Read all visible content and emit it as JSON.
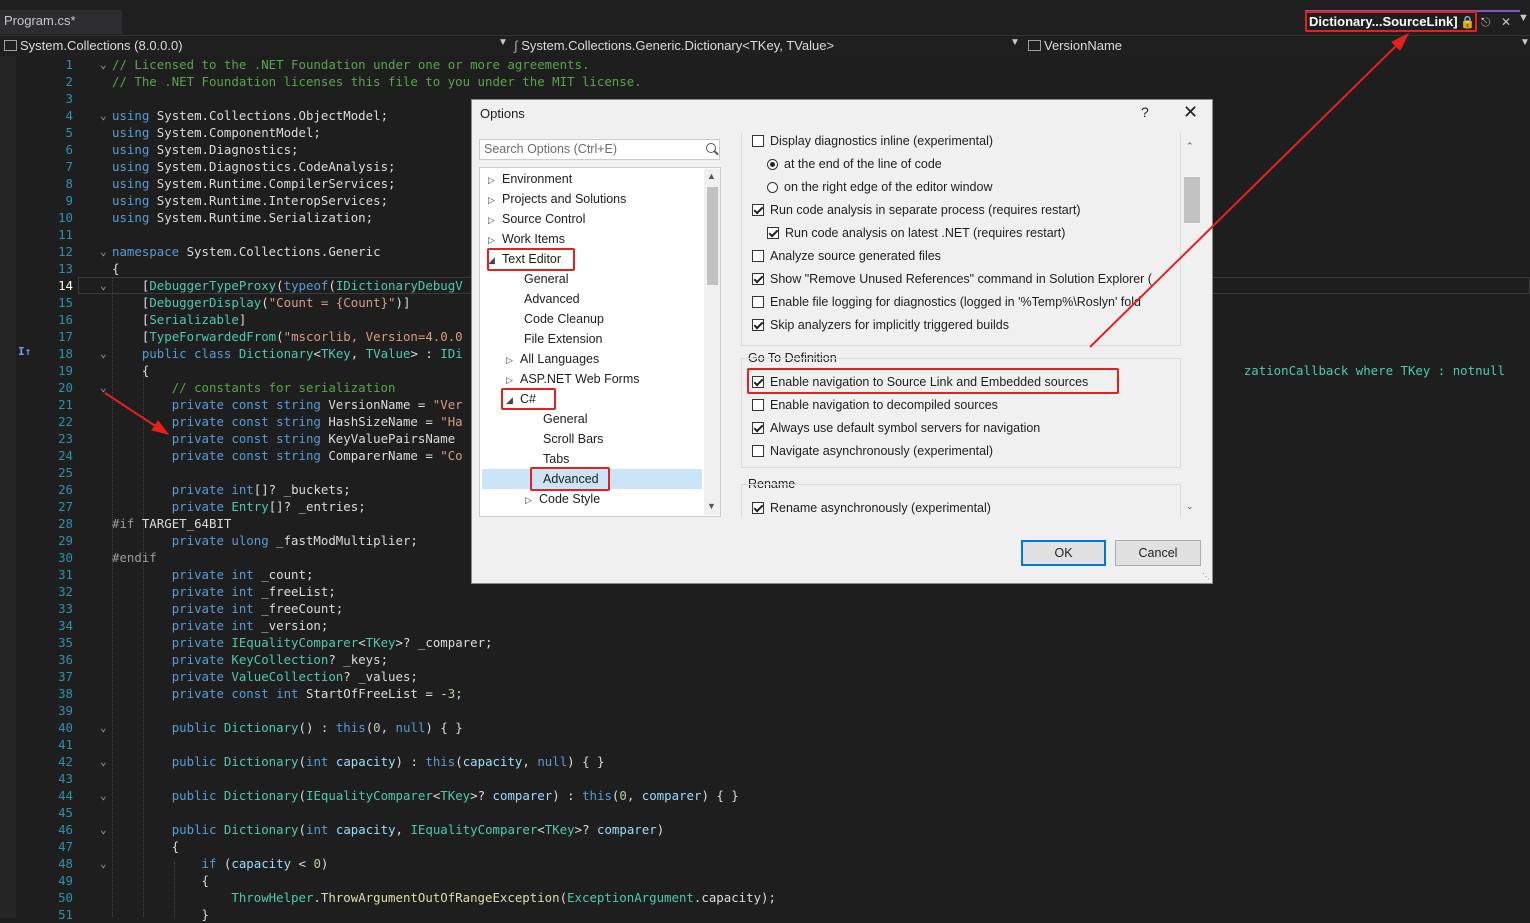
{
  "tabs": {
    "program": "Program.cs*",
    "active": "Dictionary...SourceLink]"
  },
  "navbar": {
    "project": "System.Collections (8.0.0.0)",
    "type": "System.Collections.Generic.Dictionary<TKey, TValue>",
    "member": "VersionName"
  },
  "editor": {
    "line_numbers": [
      "1",
      "2",
      "3",
      "4",
      "5",
      "6",
      "7",
      "8",
      "9",
      "10",
      "11",
      "12",
      "13",
      "14",
      "15",
      "16",
      "17",
      "18",
      "19",
      "20",
      "21",
      "22",
      "23",
      "24",
      "25",
      "26",
      "27",
      "28",
      "29",
      "30",
      "31",
      "32",
      "33",
      "34",
      "35",
      "36",
      "37",
      "38",
      "39",
      "40",
      "41",
      "42",
      "43",
      "44",
      "45",
      "46",
      "47",
      "48",
      "49",
      "50",
      "51"
    ],
    "current_line": "14",
    "line18_overflow": "zationCallback where TKey : notnull",
    "line18_marker": "I↑"
  },
  "dialog": {
    "title": "Options",
    "help": "?",
    "close": "✕",
    "search_placeholder": "Search Options (Ctrl+E)",
    "tree": [
      "Environment",
      "Projects and Solutions",
      "Source Control",
      "Work Items",
      "Text Editor",
      "General",
      "Advanced",
      "Code Cleanup",
      "File Extension",
      "All Languages",
      "ASP.NET Web Forms",
      "C#",
      "General",
      "Scroll Bars",
      "Tabs",
      "Advanced",
      "Code Style"
    ],
    "options": {
      "diag_inline": "Display diagnostics inline (experimental)",
      "at_end": "at the end of the line of code",
      "right_edge": "on the right edge of the editor window",
      "separate_process": "Run code analysis in separate process (requires restart)",
      "latest_net": "Run code analysis on latest .NET (requires restart)",
      "source_gen": "Analyze source generated files",
      "unused_refs": "Show \"Remove Unused References\" command in Solution Explorer (",
      "file_logging": "Enable file logging for diagnostics (logged in '%Temp%\\Roslyn' fold",
      "skip_analyzers": "Skip analyzers for implicitly triggered builds",
      "goto_header": "Go To Definition",
      "source_link": "Enable navigation to Source Link and Embedded sources",
      "decompiled": "Enable navigation to decompiled sources",
      "symbol_servers": "Always use default symbol servers for navigation",
      "navigate_async": "Navigate asynchronously (experimental)",
      "rename_header": "Rename",
      "rename_async": "Rename asynchronously (experimental)"
    },
    "ok": "OK",
    "cancel": "Cancel"
  },
  "colors": {
    "annotation": "#e8201d",
    "accent": "#0078d7"
  }
}
